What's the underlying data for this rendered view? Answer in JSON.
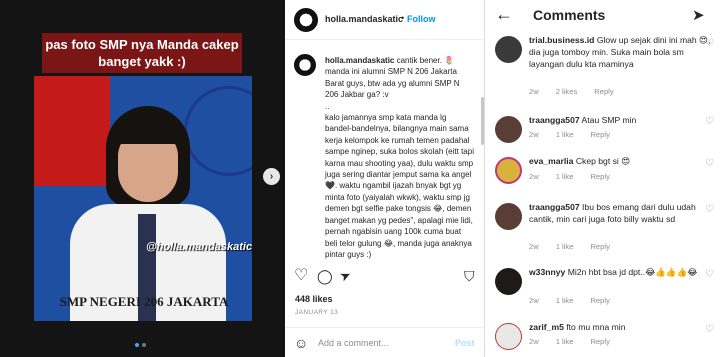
{
  "media": {
    "caption_overlay": "pas foto SMP nya Manda cakep banget yakk :)",
    "school_text": "SMP NEGERI 206 JAKARTA",
    "watermark": "@holla.mandaskatic",
    "carousel_next": "›",
    "carousel": {
      "count": 2,
      "active": 1
    }
  },
  "post": {
    "username": "holla.mandaskatic",
    "separator": "•",
    "follow_label": "Follow",
    "caption_user": "holla.mandaskatic",
    "caption_text": " cantik bener. 🌷 manda ini alumni SMP N 206 Jakarta Barat guys, btw ada yg alumni SMP N 206 Jakbar ga? :v\n..\nkalo jamannya smp kata manda lg bandel-bandelnya, bilangnya main sama kerja kelompok ke rumah temen padahal sampe nginep, suka bolos skolah (eitt tapi karna mau shooting yaa), dulu waktu smp juga sering diantar jemput sama ka angel 🖤. waktu ngambil ijazah bnyak bgt yg minta foto (yaiyalah wkwk), waktu smp jg demen bgt selfie pake tongsis 😂, demen banget makan yg pedes\", apalagi mie lidi, pernah ngabisin uang 100k cuma buat beli telor gulung 😂, manda juga anaknya pintar guys :)",
    "likes": "448 likes",
    "date": "JANUARY 13",
    "add_comment_placeholder": "Add a comment...",
    "post_label": "Post"
  },
  "comments_panel": {
    "title": "Comments",
    "items": [
      {
        "user": "trial.business.id",
        "text": " Glow up sejak dini ini mah 😍, dia juga tomboy min. Suka main bola sm layangan dulu kta maminya",
        "time": "2w",
        "likes": "2 likes",
        "reply": "Reply"
      },
      {
        "user": "traangga507",
        "text": " Atau SMP min",
        "time": "2w",
        "likes": "1 like",
        "reply": "Reply"
      },
      {
        "user": "eva_marlia",
        "text": " Ckep bgt si 😍",
        "time": "2w",
        "likes": "1 like",
        "reply": "Reply"
      },
      {
        "user": "traangga507",
        "text": " Ibu bos emang dari dulu udah cantik, min cari juga foto billy waktu sd",
        "time": "2w",
        "likes": "1 like",
        "reply": "Reply"
      },
      {
        "user": "w33nnyy",
        "text": " Mi2n hbt bsa jd dpt..😂👍👍👍😂",
        "time": "2w",
        "likes": "1 like",
        "reply": "Reply"
      },
      {
        "user": "zarif_m5",
        "text": " fto mu mna min",
        "time": "2w",
        "likes": "1 like",
        "reply": "Reply"
      }
    ]
  },
  "icons": {
    "heart": "♡",
    "comment": "◯",
    "share": "➤",
    "bookmark": "⛉",
    "smile": "☺",
    "back": "←",
    "send": "➤"
  },
  "colors": {
    "accent": "#0095f6",
    "overlay": "#7a1616",
    "meta": "#8e8e8e"
  }
}
